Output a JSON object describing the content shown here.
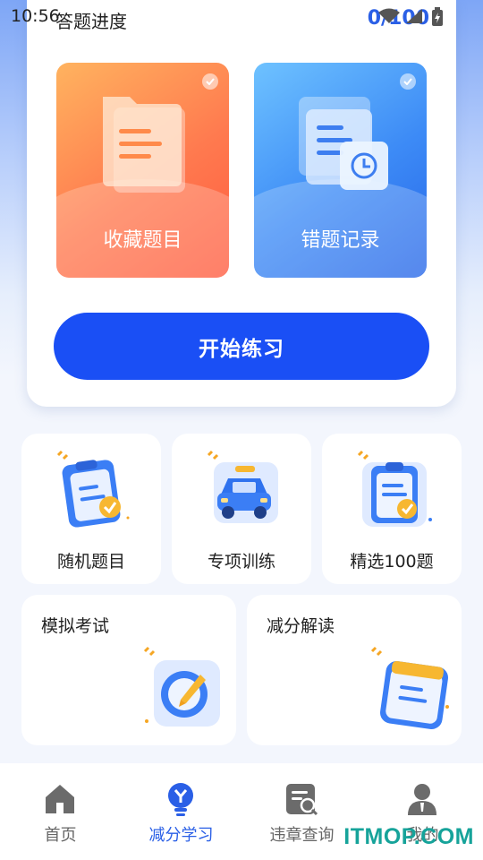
{
  "status_bar": {
    "time": "10:56"
  },
  "header": {
    "progress_label": "答题进度",
    "progress_value": "0/100"
  },
  "feature_cards": [
    {
      "label": "收藏题目",
      "icon": "folder-icon"
    },
    {
      "label": "错题记录",
      "icon": "document-clock-icon"
    }
  ],
  "start_button": {
    "label": "开始练习"
  },
  "tiles": [
    {
      "label": "随机题目",
      "icon": "clipboard-check-icon"
    },
    {
      "label": "专项训练",
      "icon": "car-icon"
    },
    {
      "label": "精选100题",
      "icon": "clipboard-list-icon"
    },
    {
      "label": "模拟考试",
      "icon": "exam-pen-icon"
    },
    {
      "label": "减分解读",
      "icon": "calendar-notepad-icon"
    }
  ],
  "bottom_nav": [
    {
      "label": "首页",
      "icon": "home-icon"
    },
    {
      "label": "减分学习",
      "icon": "bulb-icon",
      "active": true
    },
    {
      "label": "违章查询",
      "icon": "doc-search-icon"
    },
    {
      "label": "我的",
      "icon": "person-icon"
    }
  ],
  "watermark": "ITMOP.COM",
  "colors": {
    "accent": "#1a4ff5",
    "active_tab": "#2a5fe6",
    "orange": "#ff7a4f",
    "blue": "#3d8bf6"
  }
}
